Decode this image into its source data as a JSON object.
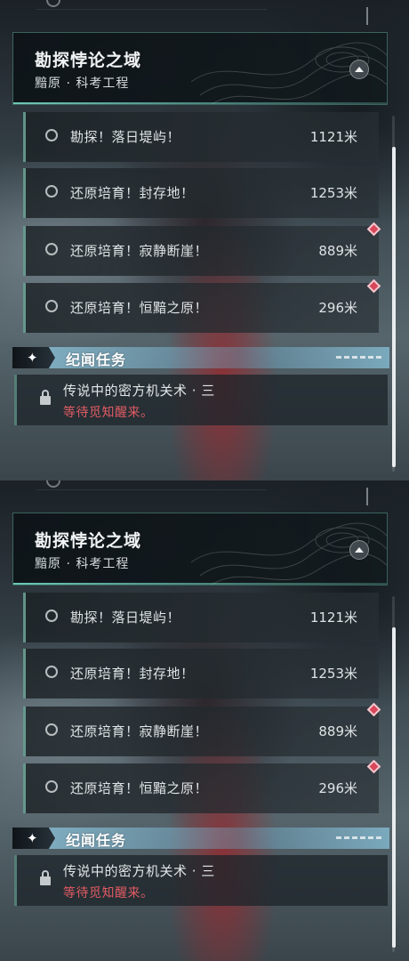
{
  "panels": [
    {
      "area": {
        "title": "勘探悖论之域",
        "subtitle": "黯原 · 科考工程"
      },
      "quests": [
        {
          "name": "勘探！落日堤屿！",
          "distance": "1121米",
          "alert": false
        },
        {
          "name": "还原培育！封存地！",
          "distance": "1253米",
          "alert": false
        },
        {
          "name": "还原培育！寂静断崖！",
          "distance": "889米",
          "alert": true
        },
        {
          "name": "还原培育！恒黯之原！",
          "distance": "296米",
          "alert": true
        }
      ],
      "section": {
        "title": "纪闻任务"
      },
      "lore": {
        "title": "传说中的密方机关术 · 三",
        "status": "等待觅知醒来。"
      }
    },
    {
      "area": {
        "title": "勘探悖论之域",
        "subtitle": "黯原 · 科考工程"
      },
      "quests": [
        {
          "name": "勘探！落日堤屿！",
          "distance": "1121米",
          "alert": false
        },
        {
          "name": "还原培育！封存地！",
          "distance": "1253米",
          "alert": false
        },
        {
          "name": "还原培育！寂静断崖！",
          "distance": "889米",
          "alert": true
        },
        {
          "name": "还原培育！恒黯之原！",
          "distance": "296米",
          "alert": true
        }
      ],
      "section": {
        "title": "纪闻任务"
      },
      "lore": {
        "title": "传说中的密方机关术 · 三",
        "status": "等待觅知醒来。"
      }
    }
  ],
  "icons": {
    "quest_status": "circle-icon",
    "alert": "red-diamond-icon",
    "collapse": "chevron-up-icon",
    "section": "sparkle-star-icon",
    "locked": "lock-icon"
  },
  "colors": {
    "accent": "#78dcc8",
    "alert": "#d9475a",
    "status_text": "#e05b63",
    "section_bar": "#96d2eb"
  }
}
